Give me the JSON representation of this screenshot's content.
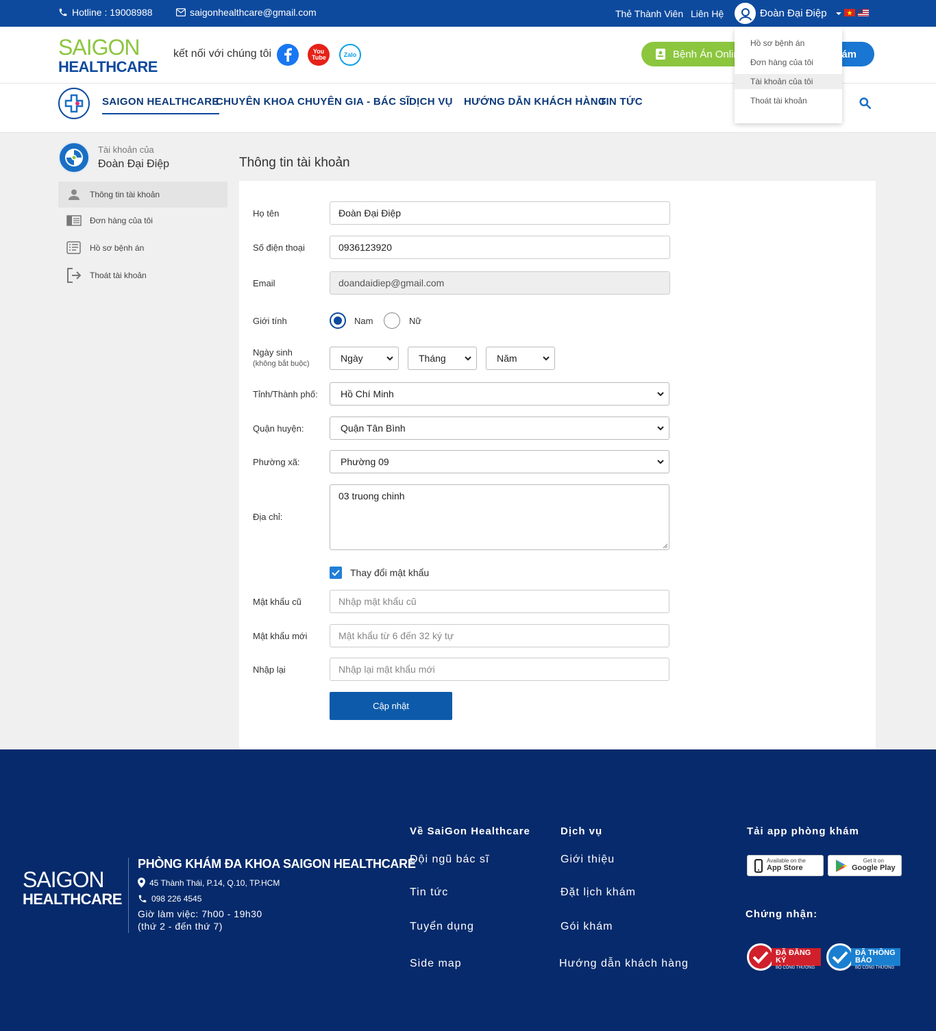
{
  "topbar": {
    "hotline": "Hotline : 19008988",
    "email": "saigonhealthcare@gmail.com",
    "member_card": "Thẻ Thành Viên",
    "contact": "Liên Hệ",
    "user_name": "Đoàn Đại Điệp"
  },
  "header": {
    "logo_line1": "SAIGON",
    "logo_line2": "HEALTHCARE",
    "connect_text": "kết nối với chúng tôi",
    "youtube_label": "You Tube",
    "zalo_label": "Zalo",
    "btn_records": "Bệnh Án Online",
    "btn_booking": "ám"
  },
  "nav": {
    "items": [
      "SAIGON HEALTHCARE",
      "CHUYÊN KHOA",
      "CHUYÊN GIA - BÁC SĨ",
      "DỊCH VỤ",
      "HƯỚNG DẪN KHÁCH HÀNG",
      "TIN TỨC"
    ]
  },
  "dropdown": {
    "items": [
      "Hồ sơ bệnh án",
      "Đơn hàng của tôi",
      "Tài khoản của tôi",
      "Thoát tài khoản"
    ]
  },
  "sidebar": {
    "account_of": "Tài khoản của",
    "name": "Đoàn Đại Điệp",
    "items": [
      "Thông tin tài khoản",
      "Đơn hàng của tôi",
      "Hồ sơ bệnh án",
      "Thoát tài khoản"
    ]
  },
  "form": {
    "title": "Thông tin tài khoản",
    "fullname_label": "Họ tên",
    "fullname_value": "Đoàn Đại Điệp",
    "phone_label": "Số điện thoại",
    "phone_value": "0936123920",
    "email_label": "Email",
    "email_value": "doandaidiep@gmail.com",
    "gender_label": "Giới tính",
    "gender_male": "Nam",
    "gender_female": "Nữ",
    "dob_label": "Ngày sinh",
    "dob_sub": "(không bắt buộc)",
    "dob_day": "Ngày",
    "dob_month": "Tháng",
    "dob_year": "Năm",
    "province_label": "Tỉnh/Thành phố:",
    "province_value": "Hồ Chí Minh",
    "district_label": "Quận huyện:",
    "district_value": "Quận Tân Bình",
    "ward_label": "Phường xã:",
    "ward_value": "Phường 09",
    "address_label": "Địa chỉ:",
    "address_value": "03 truong chinh",
    "change_password_label": "Thay đổi mật khẩu",
    "old_password_label": "Mật khẩu cũ",
    "old_password_placeholder": "Nhập mật khẩu cũ",
    "new_password_label": "Mật khẩu mới",
    "new_password_placeholder": "Mật khẩu từ 6 đến 32 ký tự",
    "confirm_password_label": "Nhập lại",
    "confirm_password_placeholder": "Nhập lại mật khẩu mới",
    "submit_label": "Cập nhật"
  },
  "footer": {
    "logo_line1": "SAIGON",
    "logo_line2": "HEALTHCARE",
    "clinic_name": "PHÒNG KHÁM ĐA KHOA SAIGON HEALTHCARE",
    "address": "45 Thành Thái, P.14, Q.10, TP.HCM",
    "phone": "098 226 4545",
    "hours": "Giờ làm việc: 7h00 - 19h30",
    "days": "(thứ 2 - đến thứ 7)",
    "col1_title": "Về SaiGon Healthcare",
    "col1_links": [
      "Đội ngũ bác sĩ",
      "Tin tức",
      "Tuyển dụng",
      "Side map"
    ],
    "col2_title": "Dịch vụ",
    "col2_links": [
      "Giới thiệu",
      "Đặt lịch khám",
      "Gói khám",
      "Hướng dẫn khách hàng"
    ],
    "app_title": "Tải app phòng khám",
    "appstore_small": "Available on the",
    "appstore_big": "App Store",
    "googleplay_small": "Get it on",
    "googleplay_big": "Google Play",
    "cert_title": "Chứng nhận:",
    "cert1_big": "ĐÃ ĐĂNG KÝ",
    "cert1_small": "BỘ CÔNG THƯƠNG",
    "cert2_big": "ĐÃ THÔNG BÁO",
    "cert2_small": "BỘ CÔNG THƯƠNG"
  },
  "colors": {
    "primary": "#0d4a9e",
    "green": "#8cc63f",
    "footer_bg": "#062a6b"
  }
}
